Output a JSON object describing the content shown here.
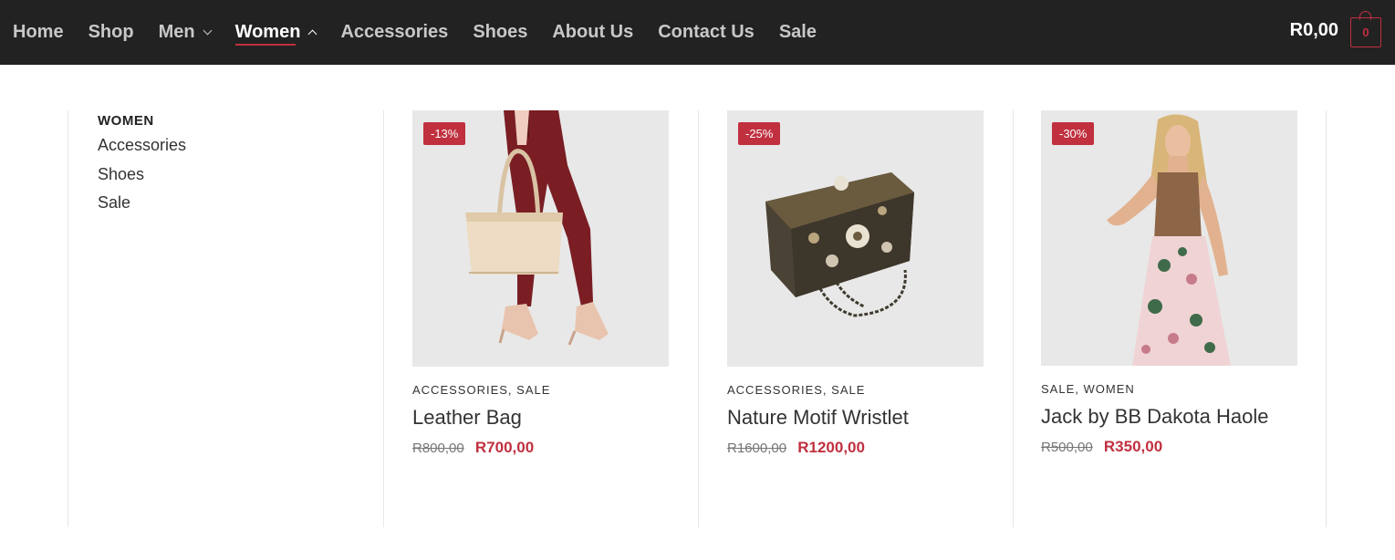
{
  "nav": {
    "items": [
      {
        "label": "Home"
      },
      {
        "label": "Shop"
      },
      {
        "label": "Men"
      },
      {
        "label": "Women"
      },
      {
        "label": "Accessories"
      },
      {
        "label": "Shoes"
      },
      {
        "label": "About Us"
      },
      {
        "label": "Contact Us"
      },
      {
        "label": "Sale"
      }
    ],
    "active": "Women",
    "cart_total": "R0,00",
    "cart_count": "0"
  },
  "mega_menu": {
    "heading": "WOMEN",
    "links": [
      "Accessories",
      "Shoes",
      "Sale"
    ],
    "products": [
      {
        "badge": "-13%",
        "categories": [
          "ACCESSORIES",
          "SALE"
        ],
        "name": "Leather Bag",
        "old_price": "R800,00",
        "price": "R700,00",
        "image_icon": "leather-bag-photo"
      },
      {
        "badge": "-25%",
        "categories": [
          "ACCESSORIES",
          "SALE"
        ],
        "name": "Nature Motif Wristlet",
        "old_price": "R1600,00",
        "price": "R1200,00",
        "image_icon": "wristlet-photo"
      },
      {
        "badge": "-30%",
        "categories": [
          "SALE",
          "WOMEN"
        ],
        "name": "Jack by BB Dakota Haole",
        "old_price": "R500,00",
        "price": "R350,00",
        "image_icon": "floral-skirt-photo"
      }
    ]
  },
  "colors": {
    "topbar": "#222222",
    "accent": "#c0303f",
    "image_bg": "#e8e8e8"
  }
}
